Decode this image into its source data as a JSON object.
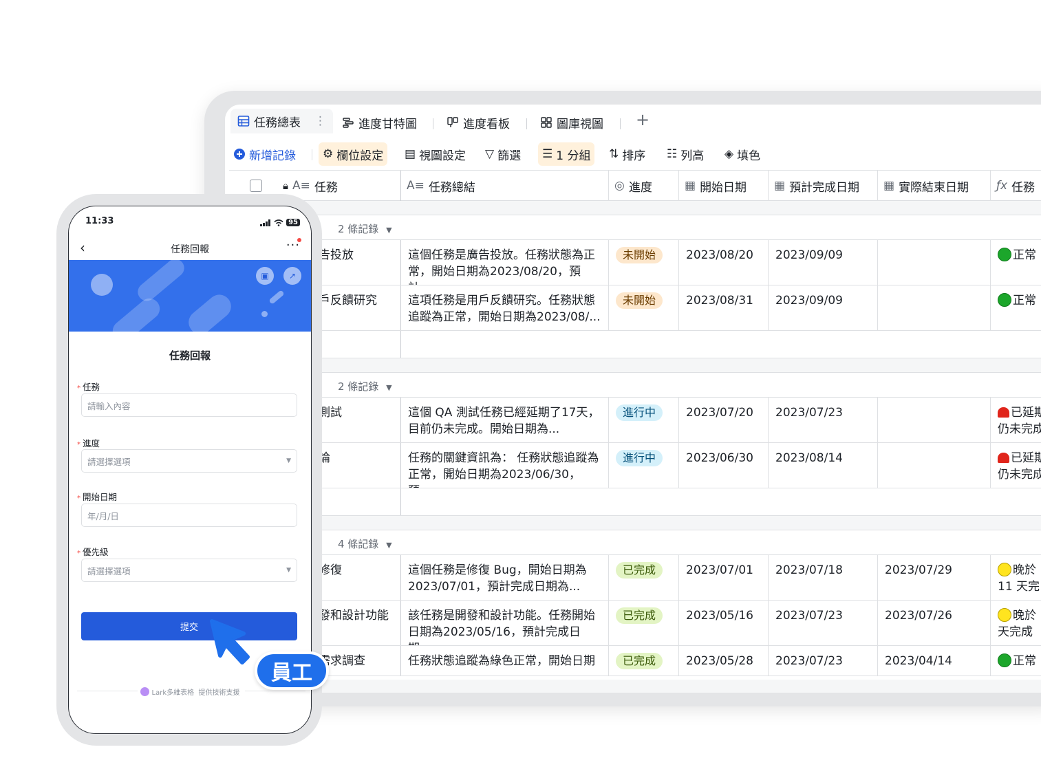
{
  "desktop": {
    "tabs": [
      {
        "label": "任務總表",
        "icon": "grid-table-icon"
      },
      {
        "label": "進度甘特圖",
        "icon": "gantt-icon"
      },
      {
        "label": "進度看板",
        "icon": "kanban-icon"
      },
      {
        "label": "圖庫視圖",
        "icon": "gallery-icon"
      }
    ],
    "toolbar": {
      "add_record": "新增記錄",
      "field_settings": "欄位設定",
      "view_settings": "視圖設定",
      "filter": "篩選",
      "group": "1 分組",
      "sort": "排序",
      "row_height": "列高",
      "fill_color": "填色"
    },
    "columns": [
      "任務",
      "任務總結",
      "進度",
      "開始日期",
      "預計完成日期",
      "實際結束日期",
      "任務"
    ],
    "groups": [
      {
        "count": "2 條記錄",
        "rows": [
          {
            "task": "告投放",
            "summary": "這個任務是廣告投放。任務狀態為正常，開始日期為2023/08/20，預計...",
            "progress": "未開始",
            "status": "notstart",
            "start": "2023/08/20",
            "planned": "2023/09/09",
            "actual": "",
            "health": "正常",
            "health_icon": "green-dot-icon"
          },
          {
            "task": "戶反饋研究",
            "summary": "這項任務是用戶反饋研究。任務狀態追蹤為正常，開始日期為2023/08/...",
            "progress": "未開始",
            "status": "notstart",
            "start": "2023/08/31",
            "planned": "2023/09/09",
            "actual": "",
            "health": "正常",
            "health_icon": "green-dot-icon"
          }
        ]
      },
      {
        "count": "2 條記錄",
        "rows": [
          {
            "task": "測試",
            "summary": "這個 QA 測試任務已經延期了17天，目前仍未完成。開始日期為...",
            "progress": "進行中",
            "status": "progress",
            "start": "2023/07/20",
            "planned": "2023/07/23",
            "actual": "",
            "health": "已延期",
            "health2": "仍未完成",
            "health_icon": "alarm-icon"
          },
          {
            "task": "論",
            "summary": "任務的關鍵資訊為： 任務狀態追蹤為正常，開始日期為2023/06/30，預...",
            "progress": "進行中",
            "status": "progress",
            "start": "2023/06/30",
            "planned": "2023/08/14",
            "actual": "",
            "health": "已延期",
            "health2": "仍未完成",
            "health_icon": "alarm-icon"
          }
        ]
      },
      {
        "count": "4 條記錄",
        "rows": [
          {
            "task": "修復",
            "summary": "這個任務是修復 Bug，開始日期為2023/07/01，預計完成日期為...",
            "progress": "已完成",
            "status": "done",
            "start": "2023/07/01",
            "planned": "2023/07/18",
            "actual": "2023/07/29",
            "health": "晚於",
            "health2": "11 天完",
            "health_icon": "yellow-dot-icon"
          },
          {
            "task": "發和設計功能",
            "summary": "該任務是開發和設計功能。任務開始日期為2023/05/16，預計完成日期...",
            "progress": "已完成",
            "status": "done",
            "start": "2023/05/16",
            "planned": "2023/07/23",
            "actual": "2023/07/26",
            "health": "晚於",
            "health2": "天完成",
            "health_icon": "yellow-dot-icon"
          },
          {
            "task": "需求調查",
            "summary": "任務狀態追蹤為綠色正常，開始日期",
            "progress": "已完成",
            "status": "done",
            "start": "2023/05/28",
            "planned": "2023/07/23",
            "actual": "2023/04/14",
            "health": "正常",
            "health_icon": "green-dot-icon"
          }
        ]
      }
    ]
  },
  "phone": {
    "time": "11:33",
    "battery": "95",
    "nav_title": "任務回報",
    "form_title": "任務回報",
    "fields": [
      {
        "label": "任務",
        "placeholder": "請輸入內容",
        "type": "text"
      },
      {
        "label": "進度",
        "placeholder": "請選擇選項",
        "type": "select"
      },
      {
        "label": "開始日期",
        "placeholder": "年/月/日",
        "type": "date"
      },
      {
        "label": "優先級",
        "placeholder": "請選擇選項",
        "type": "select"
      }
    ],
    "submit": "提交",
    "powered_by": "Lark多維表格",
    "powered_suffix": "提供技術支援"
  },
  "badge": "員工",
  "colors": {
    "accent": "#245bdb",
    "banner": "#3370eb",
    "badge": "#1f6feb"
  }
}
